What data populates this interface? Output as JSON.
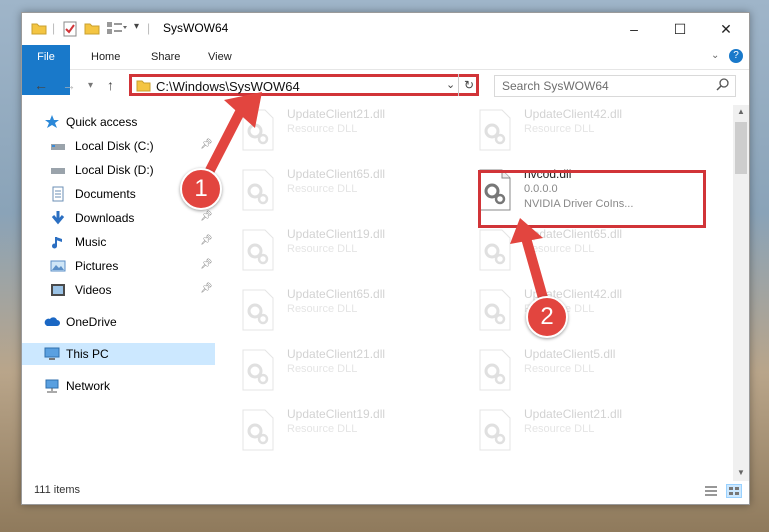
{
  "window": {
    "title": "SysWOW64",
    "minimize": "–",
    "maximize": "☐",
    "close": "✕"
  },
  "ribbon": {
    "tabs": [
      "File",
      "Home",
      "Share",
      "View"
    ]
  },
  "address": {
    "path": "C:\\Windows\\SysWOW64"
  },
  "search": {
    "placeholder": "Search SysWOW64"
  },
  "sidebar": {
    "items": [
      {
        "label": "Quick access",
        "icon": "star-icon"
      },
      {
        "label": "Local Disk (C:)",
        "icon": "drive-icon"
      },
      {
        "label": "Local Disk (D:)",
        "icon": "drive-icon"
      },
      {
        "label": "Documents",
        "icon": "documents-icon"
      },
      {
        "label": "Downloads",
        "icon": "download-icon"
      },
      {
        "label": "Music",
        "icon": "music-icon"
      },
      {
        "label": "Pictures",
        "icon": "pictures-icon"
      },
      {
        "label": "Videos",
        "icon": "videos-icon"
      },
      {
        "label": "OneDrive",
        "icon": "cloud-icon"
      },
      {
        "label": "This PC",
        "icon": "computer-icon"
      },
      {
        "label": "Network",
        "icon": "network-icon"
      }
    ]
  },
  "files": [
    {
      "name": "UpdateClient21.dll",
      "sub": "Resource DLL"
    },
    {
      "name": "UpdateClient42.dll",
      "sub": "Resource DLL"
    },
    {
      "name": "UpdateClient65.dll",
      "sub": "Resource DLL"
    },
    {
      "name": "nvcod.dll",
      "sub": "0.0.0.0",
      "sub2": "NVIDIA Driver CoIns..."
    },
    {
      "name": "UpdateClient19.dll",
      "sub": "Resource DLL"
    },
    {
      "name": "UpdateClient65.dll",
      "sub": "Resource DLL"
    },
    {
      "name": "UpdateClient65.dll",
      "sub": "Resource DLL"
    },
    {
      "name": "UpdateClient42.dll",
      "sub": "Resource DLL"
    },
    {
      "name": "UpdateClient21.dll",
      "sub": "Resource DLL"
    },
    {
      "name": "UpdateClient5.dll",
      "sub": "Resource DLL"
    },
    {
      "name": "UpdateClient19.dll",
      "sub": "Resource DLL"
    },
    {
      "name": "UpdateClient21.dll",
      "sub": "Resource DLL"
    }
  ],
  "status": {
    "items": "111 items"
  },
  "callouts": [
    "1",
    "2"
  ],
  "colors": {
    "accent": "#1979ca",
    "highlight": "#d13438",
    "callout": "#e2453f",
    "selected": "#cce8ff"
  }
}
